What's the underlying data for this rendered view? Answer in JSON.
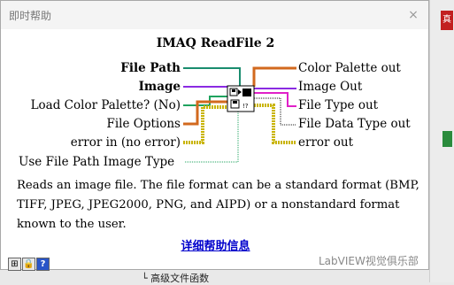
{
  "window": {
    "title": "即时帮助",
    "close_symbol": "×"
  },
  "vi": {
    "title": "IMAQ ReadFile 2",
    "inputs": [
      {
        "label": "File Path",
        "bold": true
      },
      {
        "label": "Image",
        "bold": true
      },
      {
        "label": "Load Color Palette? (No)",
        "bold": false
      },
      {
        "label": "File Options",
        "bold": false
      },
      {
        "label": "error in (no error)",
        "bold": false
      },
      {
        "label": "Use File Path Image Type",
        "bold": false
      }
    ],
    "outputs": [
      {
        "label": "Color Palette out"
      },
      {
        "label": "Image Out"
      },
      {
        "label": "File Type out"
      },
      {
        "label": "File Data Type out"
      },
      {
        "label": "error out"
      }
    ]
  },
  "description": "Reads an image file. The file format can be a standard format (BMP, TIFF, JPEG, JPEG2000, PNG, and AIPD) or a nonstandard format known to the user.",
  "detail_link": "详细帮助信息",
  "bottom_buttons": [
    {
      "name": "simple-diagram-button",
      "glyph": "⊞"
    },
    {
      "name": "lock-button",
      "glyph": "🔒"
    },
    {
      "name": "help-button",
      "glyph": "?"
    }
  ],
  "background": {
    "partial_text": "└ 高级文件函数",
    "side_tab": "真",
    "watermark": "LabVIEW视觉俱乐部"
  },
  "colors": {
    "path_wire": "#1a8c6e",
    "image_wire": "#8a2be2",
    "palette_wire": "#d2691e",
    "cluster_wire": "#d2691e",
    "error_wire": "#c9b400",
    "bool_wire": "#1fa35f",
    "type_wire": "#e020c8",
    "link": "#0000cc"
  }
}
